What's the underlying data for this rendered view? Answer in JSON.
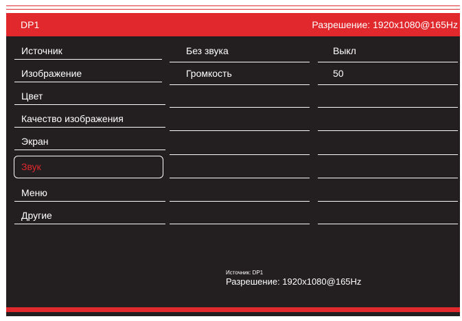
{
  "header": {
    "input": "DP1",
    "resolution": "Разрешение: 1920x1080@165Hz"
  },
  "menu": {
    "items": [
      {
        "label": "Источник"
      },
      {
        "label": "Изображение"
      },
      {
        "label": "Цвет"
      },
      {
        "label": "Качество изображения"
      },
      {
        "label": "Экран"
      },
      {
        "label": "Звук",
        "selected": true
      },
      {
        "label": "Меню"
      },
      {
        "label": "Другие"
      }
    ]
  },
  "sound": {
    "rows": [
      {
        "name": "Без звука",
        "value": "Выкл"
      },
      {
        "name": "Громкость",
        "value": "50"
      }
    ]
  },
  "footer": {
    "source": "Источник: DP1",
    "resolution": "Разрешение: 1920x1080@165Hz"
  },
  "colors": {
    "accent": "#e0282d",
    "background": "#231f20",
    "text": "#ffffff"
  }
}
